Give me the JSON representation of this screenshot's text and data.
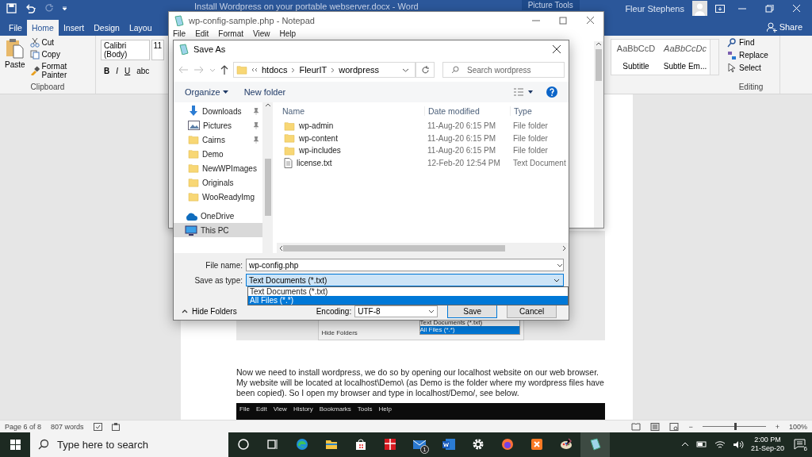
{
  "word": {
    "title": "Install Wordpress on your portable webserver.docx - Word",
    "context_tab": "Picture Tools",
    "user": "Fleur Stephens",
    "share": "Share",
    "tabs": [
      {
        "label": "File",
        "selected": false
      },
      {
        "label": "Home",
        "selected": true
      },
      {
        "label": "Insert",
        "selected": false
      },
      {
        "label": "Design",
        "selected": false
      },
      {
        "label": "Layou",
        "selected": false
      }
    ],
    "clipboard": {
      "paste": "Paste",
      "cut": "Cut",
      "copy": "Copy",
      "format_painter": "Format Painter",
      "label": "Clipboard"
    },
    "font": {
      "name": "Calibri (Body)",
      "size": "11",
      "buttons": [
        "B",
        "I",
        "U",
        "abc"
      ]
    },
    "styles": [
      {
        "preview": "AaBbCcD",
        "label": "Subtitle",
        "italic": false
      },
      {
        "preview": "AaBbCcDc",
        "label": "Subtle Em...",
        "italic": true
      }
    ],
    "editing": {
      "find": "Find",
      "replace": "Replace",
      "select": "Select",
      "label": "Editing"
    }
  },
  "document": {
    "embedded_screenshot": {
      "hide_folders": "Hide Folders",
      "options": [
        {
          "label": "Text Documents (*.txt)",
          "selected": false
        },
        {
          "label": "All Files (*.*)",
          "selected": true
        }
      ]
    },
    "paragraph": "Now we need to install wordpress, we do so by opening our localhost website on our web browser. My website will be located at localhost\\Demo\\ (as Demo is the folder where my wordpress files have been copied).  So I open my browser and type in localhost/Demo/, see below.",
    "browser_menu": [
      "File",
      "Edit",
      "View",
      "History",
      "Bookmarks",
      "Tools",
      "Help"
    ]
  },
  "status_bar": {
    "page": "Page 6 of 8",
    "words": "807 words",
    "zoom": {
      "level": 0.5
    },
    "zoom_out": "−",
    "zoom_in": "+",
    "zoom_text": "100%"
  },
  "notepad": {
    "title": "wp-config-sample.php - Notepad",
    "menu": [
      "File",
      "Edit",
      "Format",
      "View",
      "Help"
    ]
  },
  "save_as": {
    "title": "Save As",
    "path": [
      "htdocs",
      "FleurIT",
      "wordpress"
    ],
    "search": {
      "placeholder": "Search wordpress"
    },
    "organize": "Organize",
    "new_folder": "New folder",
    "nav": [
      {
        "label": "Downloads",
        "kind": "download",
        "pinned": true,
        "selected": false
      },
      {
        "label": "Pictures",
        "kind": "pictures",
        "pinned": true,
        "selected": false
      },
      {
        "label": "Cairns",
        "kind": "folder",
        "pinned": true,
        "selected": false
      },
      {
        "label": "Demo",
        "kind": "folder",
        "pinned": false,
        "selected": false
      },
      {
        "label": "NewWPImages",
        "kind": "folder",
        "pinned": false,
        "selected": false
      },
      {
        "label": "Originals",
        "kind": "folder",
        "pinned": false,
        "selected": false
      },
      {
        "label": "WooReadyImg",
        "kind": "folder",
        "pinned": false,
        "selected": false
      },
      {
        "label": "OneDrive",
        "kind": "cloud",
        "pinned": false,
        "selected": false
      },
      {
        "label": "This PC",
        "kind": "pc",
        "pinned": false,
        "selected": true
      }
    ],
    "columns": [
      "Name",
      "Date modified",
      "Type"
    ],
    "files": [
      {
        "name": "wp-admin",
        "date": "11-Aug-20 6:15 PM",
        "type": "File folder",
        "kind": "folder"
      },
      {
        "name": "wp-content",
        "date": "11-Aug-20 6:15 PM",
        "type": "File folder",
        "kind": "folder"
      },
      {
        "name": "wp-includes",
        "date": "11-Aug-20 6:15 PM",
        "type": "File folder",
        "kind": "folder"
      },
      {
        "name": "license.txt",
        "date": "12-Feb-20 12:54 PM",
        "type": "Text Document",
        "kind": "file"
      }
    ],
    "file_name_label": "File name:",
    "file_name": "wp-config.php",
    "type_label": "Save as type:",
    "type_value": "Text Documents (*.txt)",
    "type_options": [
      {
        "label": "Text Documents (*.txt)",
        "selected": false
      },
      {
        "label": "All Files  (*.*)",
        "selected": true
      }
    ],
    "hide_folders": "Hide Folders",
    "encoding_label": "Encoding:",
    "encoding": "UTF-8",
    "save": "Save",
    "cancel": "Cancel"
  },
  "taskbar": {
    "search": {
      "placeholder": "Type here to search"
    },
    "apps": [
      {
        "kind": "cortana",
        "active": false
      },
      {
        "kind": "taskview",
        "active": false
      },
      {
        "kind": "edge",
        "active": false
      },
      {
        "kind": "explorer",
        "active": false
      },
      {
        "kind": "store",
        "active": false
      },
      {
        "kind": "gift",
        "active": false
      },
      {
        "kind": "mail",
        "active": false,
        "badge": "1"
      },
      {
        "kind": "word",
        "active": false
      },
      {
        "kind": "settings",
        "active": false
      },
      {
        "kind": "firefox",
        "active": false
      },
      {
        "kind": "xampp",
        "active": false
      },
      {
        "kind": "paint",
        "active": false
      },
      {
        "kind": "notepad",
        "active": true
      }
    ],
    "time": "2:00 PM",
    "date": "21-Sep-20",
    "notifications": "6"
  }
}
